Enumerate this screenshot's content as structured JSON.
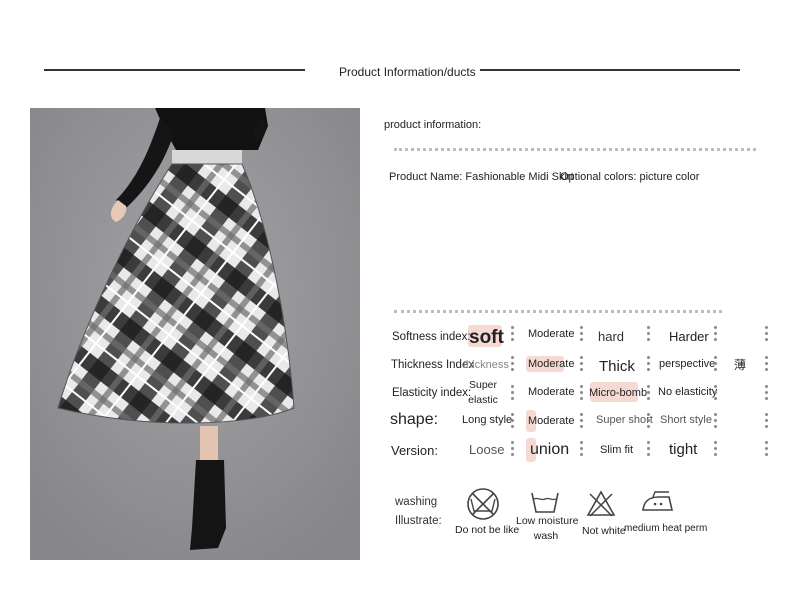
{
  "header": {
    "title": "Product Information/ducts"
  },
  "info": {
    "heading": "product information:",
    "product_name": "Product Name: Fashionable Midi Skirt",
    "optional_colors": "Optional colors: picture color"
  },
  "rows": [
    {
      "label": "Softness index:",
      "options": [
        "soft",
        "Moderate",
        "hard",
        "Harder"
      ],
      "selected": 0
    },
    {
      "label": "Thickness Index",
      "options": [
        "thickness",
        "Moderate",
        "Thick",
        "perspective"
      ],
      "selected": 1
    },
    {
      "label": "Elasticity index:",
      "options": [
        "Super elastic",
        "Moderate",
        "Micro-bomb",
        "No elasticity"
      ],
      "selected": 2
    },
    {
      "label": "shape:",
      "options": [
        "Long style",
        "Moderate",
        "Super short",
        "Short style"
      ],
      "selected": 1
    },
    {
      "label": "Version:",
      "options": [
        "Loose",
        "union",
        "Slim fit",
        "tight"
      ],
      "selected": 1
    }
  ],
  "stray_mark": "薄",
  "washing": {
    "label_line1": "washing",
    "label_line2": "Illustrate:",
    "icons": [
      {
        "icon": "do-not-wash-icon",
        "label": "Do not be like"
      },
      {
        "icon": "low-moisture-wash-icon",
        "label_line1": "Low moisture",
        "label_line2": "wash"
      },
      {
        "icon": "no-bleach-icon",
        "label": "Not white"
      },
      {
        "icon": "iron-medium-heat-icon",
        "label": "medium heat perm"
      }
    ]
  },
  "photo": {
    "description": "plaid-midi-skirt-photo"
  }
}
